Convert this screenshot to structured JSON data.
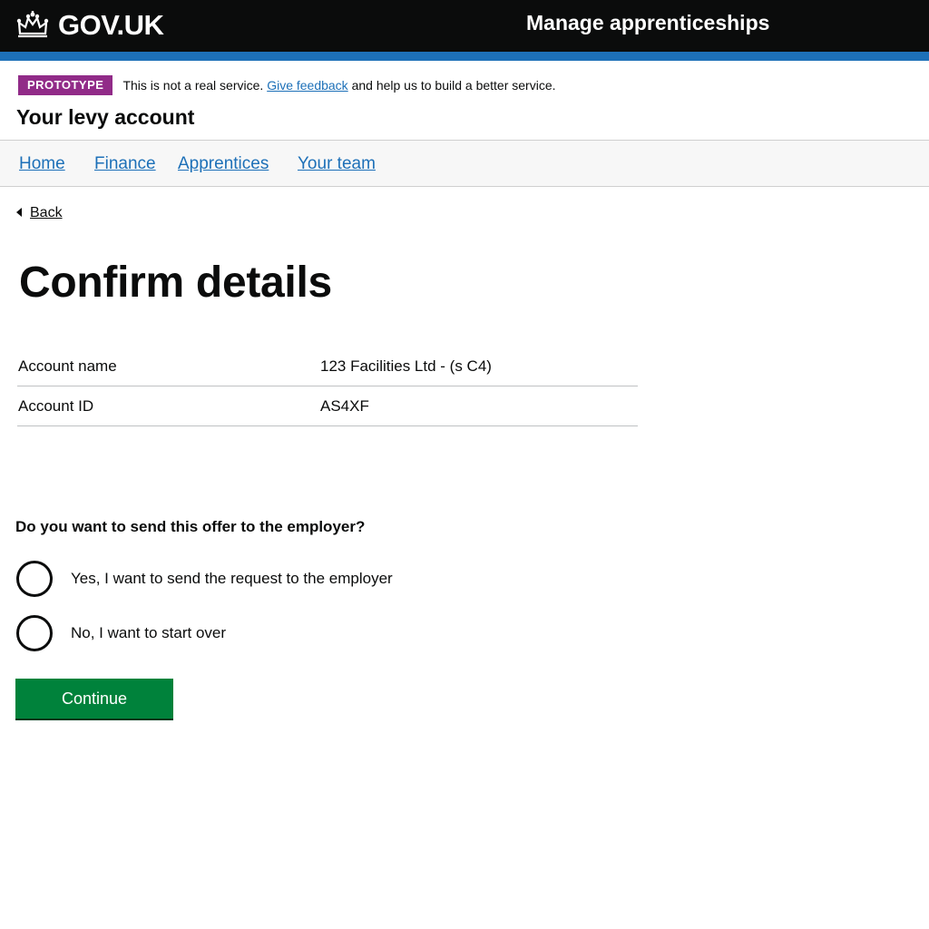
{
  "header": {
    "logo_text": "GOV.UK",
    "service_name": "Manage apprenticeships"
  },
  "phase_banner": {
    "tag": "PROTOTYPE",
    "text_before": "This is not a real service.",
    "link_text": "Give feedback",
    "text_after": "and help us to build a better service."
  },
  "account_title": "Your levy account",
  "nav": {
    "items": [
      {
        "label": "Home"
      },
      {
        "label": "Finance"
      },
      {
        "label": "Apprentices"
      },
      {
        "label": "Your team"
      }
    ]
  },
  "back_link": "Back",
  "page_heading": "Confirm details",
  "summary": [
    {
      "key": "Account name",
      "value": "123 Facilities Ltd - (s C4)"
    },
    {
      "key": "Account ID",
      "value": "AS4XF"
    }
  ],
  "question": {
    "legend": "Do you want to send this offer to the employer?",
    "options": [
      {
        "label": "Yes, I want to send the request to the employer"
      },
      {
        "label": "No, I want to start over"
      }
    ]
  },
  "continue_button": "Continue",
  "colors": {
    "header": "#0b0c0c",
    "stripe": "#1d70b8",
    "phase_tag": "#912b88",
    "link": "#1d70b8",
    "button": "#00823b"
  },
  "icons": {
    "logo": "crown-icon",
    "back": "back-arrow-icon"
  }
}
